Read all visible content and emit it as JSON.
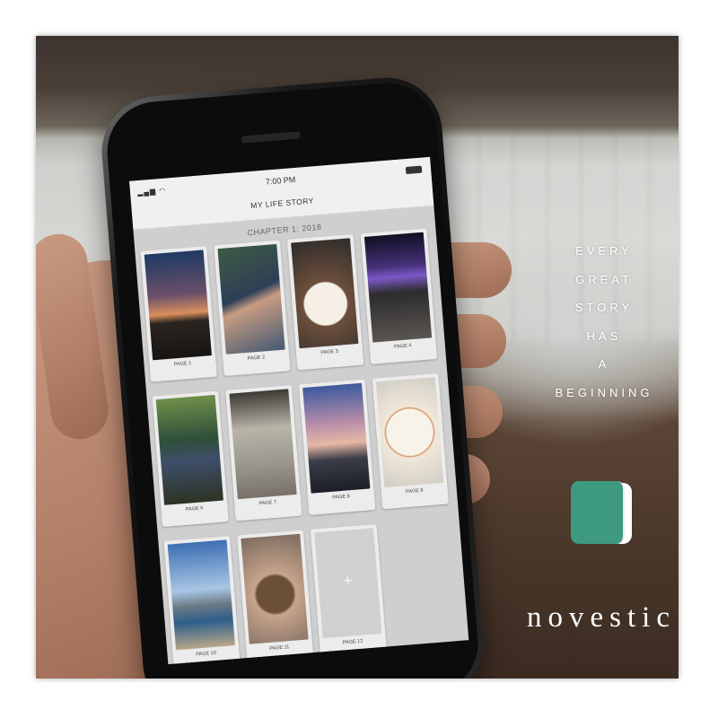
{
  "ad": {
    "tagline": [
      "EVERY",
      "GREAT",
      "STORY",
      "HAS",
      "A",
      "BEGINNING"
    ],
    "brand": "novestic",
    "logo_color": "#3d9a7f"
  },
  "phone": {
    "status": {
      "time": "7:00 PM",
      "signal_icon": "signal-wifi-icon",
      "battery_icon": "battery-icon"
    },
    "title": "MY LIFE STORY",
    "chapter": "CHAPTER 1: 2018",
    "pages": [
      {
        "label": "PAGE 1",
        "photo": "sunset-palms"
      },
      {
        "label": "PAGE 2",
        "photo": "woman-with-baby"
      },
      {
        "label": "PAGE 3",
        "photo": "fruit-bowl"
      },
      {
        "label": "PAGE 4",
        "photo": "concert-crowd"
      },
      {
        "label": "PAGE 6",
        "photo": "man-in-forest"
      },
      {
        "label": "PAGE 7",
        "photo": "person-in-street"
      },
      {
        "label": "PAGE 8",
        "photo": "city-skyline"
      },
      {
        "label": "PAGE 9",
        "photo": "food-plate"
      },
      {
        "label": "PAGE 10",
        "photo": "harbor-skyline"
      },
      {
        "label": "PAGE 11",
        "photo": "hedgehog-in-hands"
      },
      {
        "label": "PAGE 12",
        "photo": "empty",
        "add_symbol": "+"
      }
    ]
  }
}
